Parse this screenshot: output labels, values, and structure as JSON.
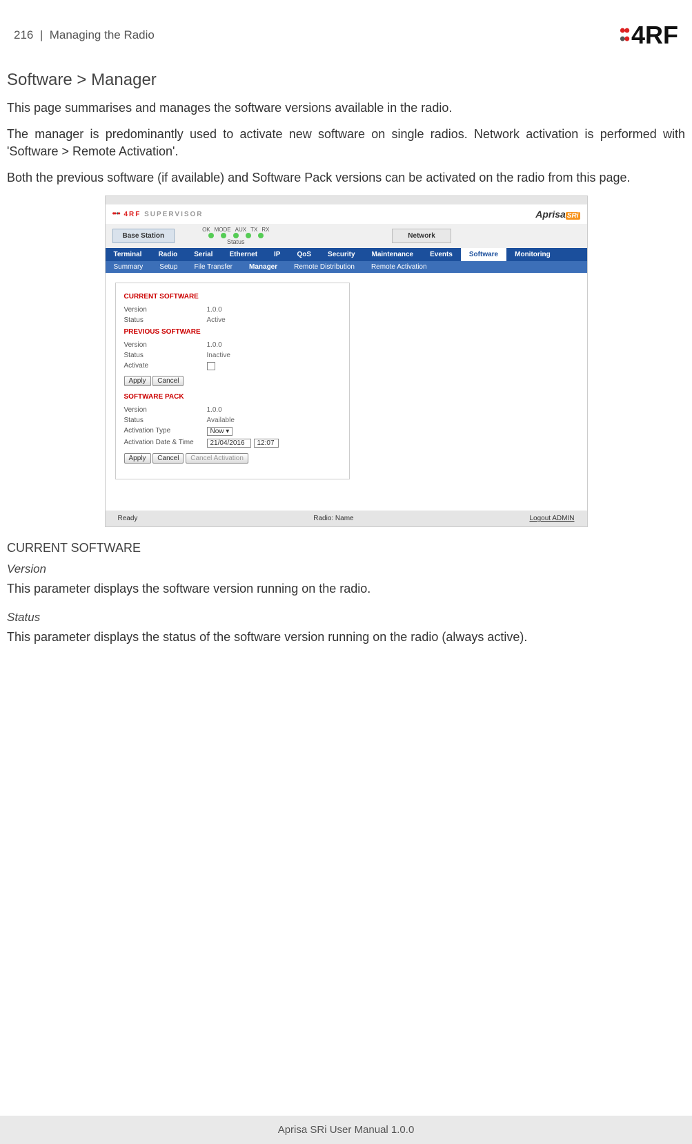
{
  "header": {
    "page_number": "216",
    "section": "Managing the Radio",
    "brand": "4RF"
  },
  "title": "Software > Manager",
  "paragraphs": {
    "p1": "This page summarises and manages the software versions available in the radio.",
    "p2": "The manager is predominantly used to activate new software on single radios. Network activation is performed with 'Software > Remote Activation'.",
    "p3": "Both the previous software (if available) and Software Pack versions can be activated on the radio from this page."
  },
  "screenshot": {
    "supervisor_label": "SUPERVISOR",
    "aprisa_label": "Aprisa",
    "aprisa_suffix": "SRi",
    "base_station": "Base Station",
    "network_btn": "Network",
    "status_label": "Status",
    "led_labels": [
      "OK",
      "MODE",
      "AUX",
      "TX",
      "RX"
    ],
    "nav": [
      "Terminal",
      "Radio",
      "Serial",
      "Ethernet",
      "IP",
      "QoS",
      "Security",
      "Maintenance",
      "Events",
      "Software",
      "Monitoring"
    ],
    "nav_active": "Software",
    "subnav": [
      "Summary",
      "Setup",
      "File Transfer",
      "Manager",
      "Remote Distribution",
      "Remote Activation"
    ],
    "subnav_active": "Manager",
    "panel": {
      "current_hdr": "CURRENT SOFTWARE",
      "prev_hdr": "PREVIOUS SOFTWARE",
      "pack_hdr": "SOFTWARE PACK",
      "labels": {
        "version": "Version",
        "status": "Status",
        "activate": "Activate",
        "activation_type": "Activation Type",
        "activation_dt": "Activation Date & Time"
      },
      "values": {
        "cur_version": "1.0.0",
        "cur_status": "Active",
        "prev_version": "1.0.0",
        "prev_status": "Inactive",
        "pack_version": "1.0.0",
        "pack_status": "Available",
        "act_type": "Now",
        "act_date": "21/04/2016",
        "act_time": "12:07"
      },
      "buttons": {
        "apply": "Apply",
        "cancel": "Cancel",
        "cancel_act": "Cancel Activation"
      }
    },
    "footer": {
      "ready": "Ready",
      "radio_name": "Radio: Name",
      "logout": "Logout ADMIN"
    }
  },
  "doc_sections": {
    "current_software": "CURRENT SOFTWARE",
    "version_hdr": "Version",
    "version_text": "This parameter displays the software version running on the radio.",
    "status_hdr": "Status",
    "status_text": "This parameter displays the status of the software version running on the radio (always active)."
  },
  "footer_text": "Aprisa SRi User Manual 1.0.0"
}
